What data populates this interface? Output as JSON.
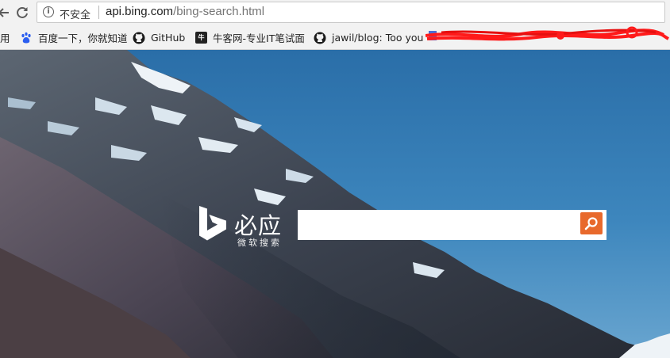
{
  "browser": {
    "security_label": "不安全",
    "url_host": "api.bing.com",
    "url_path": "/bing-search.html",
    "nav": [
      "back-arrow-icon",
      "reload-icon",
      "info-icon"
    ]
  },
  "bookmarks": {
    "items": [
      {
        "label": "用",
        "icon": "apps-icon"
      },
      {
        "label": "百度一下，你就知道",
        "icon": "baidu-paw-icon"
      },
      {
        "label": "GitHub",
        "icon": "github-icon"
      },
      {
        "label": "牛客网-专业IT笔试面",
        "icon": "nowcoder-icon"
      },
      {
        "label": "jawil/blog: Too you",
        "icon": "github-icon"
      }
    ],
    "redaction_color": "#ff1a1a"
  },
  "hero": {
    "logo_text": "必应",
    "logo_subtext": "微软搜索",
    "search_placeholder": "",
    "search_button_color": "#e8692c"
  }
}
